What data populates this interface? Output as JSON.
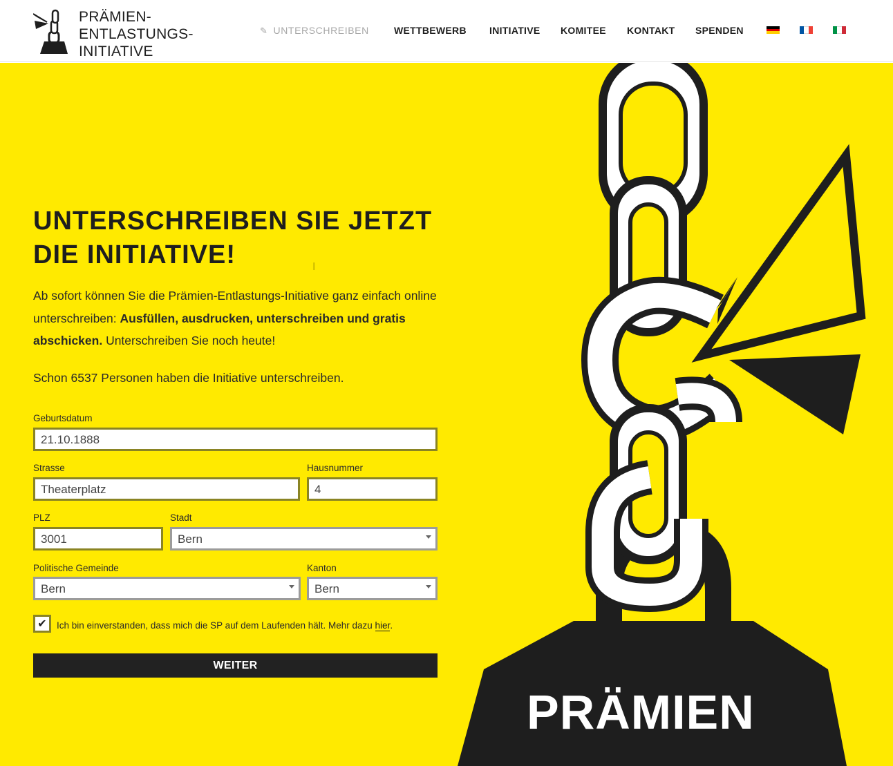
{
  "logo": {
    "line1": "PRÄMIEN-",
    "line2": "ENTLASTUNGS-",
    "line3": "INITIATIVE",
    "icon": "logo-mark-icon"
  },
  "nav": {
    "items": [
      {
        "label": "UNTERSCHREIBEN",
        "active": true,
        "icon": "pencil-icon"
      },
      {
        "label": "WETTBEWERB"
      },
      {
        "label": "INITIATIVE"
      },
      {
        "label": "KOMITEE"
      },
      {
        "label": "KONTAKT"
      },
      {
        "label": "SPENDEN"
      }
    ],
    "flags": [
      {
        "icon": "flag-de-icon",
        "colors": [
          "#000000",
          "#dd0000",
          "#ffce00"
        ]
      },
      {
        "icon": "flag-fr-icon",
        "colors": [
          "#0055a4",
          "#ffffff",
          "#ef4135"
        ]
      },
      {
        "icon": "flag-it-icon",
        "colors": [
          "#009246",
          "#ffffff",
          "#ce2b37"
        ]
      }
    ]
  },
  "hero": {
    "headline_line1": "UNTERSCHREIBEN SIE JETZT",
    "headline_line2": "DIE INITIATIVE!",
    "intro_part1": "Ab sofort können Sie die Prämien-Entlastungs-Initiative ganz einfach online unterschreiben: ",
    "intro_bold": "Ausfüllen, ausdrucken, unterschreiben und gratis abschicken.",
    "intro_part2": " Unterschreiben Sie noch heute!",
    "count_text": "Schon 6537 Personen haben die Initiative unterschreiben.",
    "background_color": "#ffea00",
    "illustration_label": "PRÄMIEN"
  },
  "form": {
    "birthdate": {
      "label": "Geburtsdatum",
      "value": "21.10.1888"
    },
    "street": {
      "label": "Strasse",
      "value": "Theaterplatz"
    },
    "house_number": {
      "label": "Hausnummer",
      "value": "4"
    },
    "zip": {
      "label": "PLZ",
      "value": "3001"
    },
    "city": {
      "label": "Stadt",
      "value": "Bern"
    },
    "municipality": {
      "label": "Politische Gemeinde",
      "value": "Bern"
    },
    "canton": {
      "label": "Kanton",
      "value": "Bern"
    },
    "consent": {
      "checked": true,
      "text": "Ich bin einverstanden, dass mich die SP auf dem Laufenden hält. Mehr dazu ",
      "link": "hier",
      "suffix": "."
    },
    "submit_label": "WEITER"
  }
}
